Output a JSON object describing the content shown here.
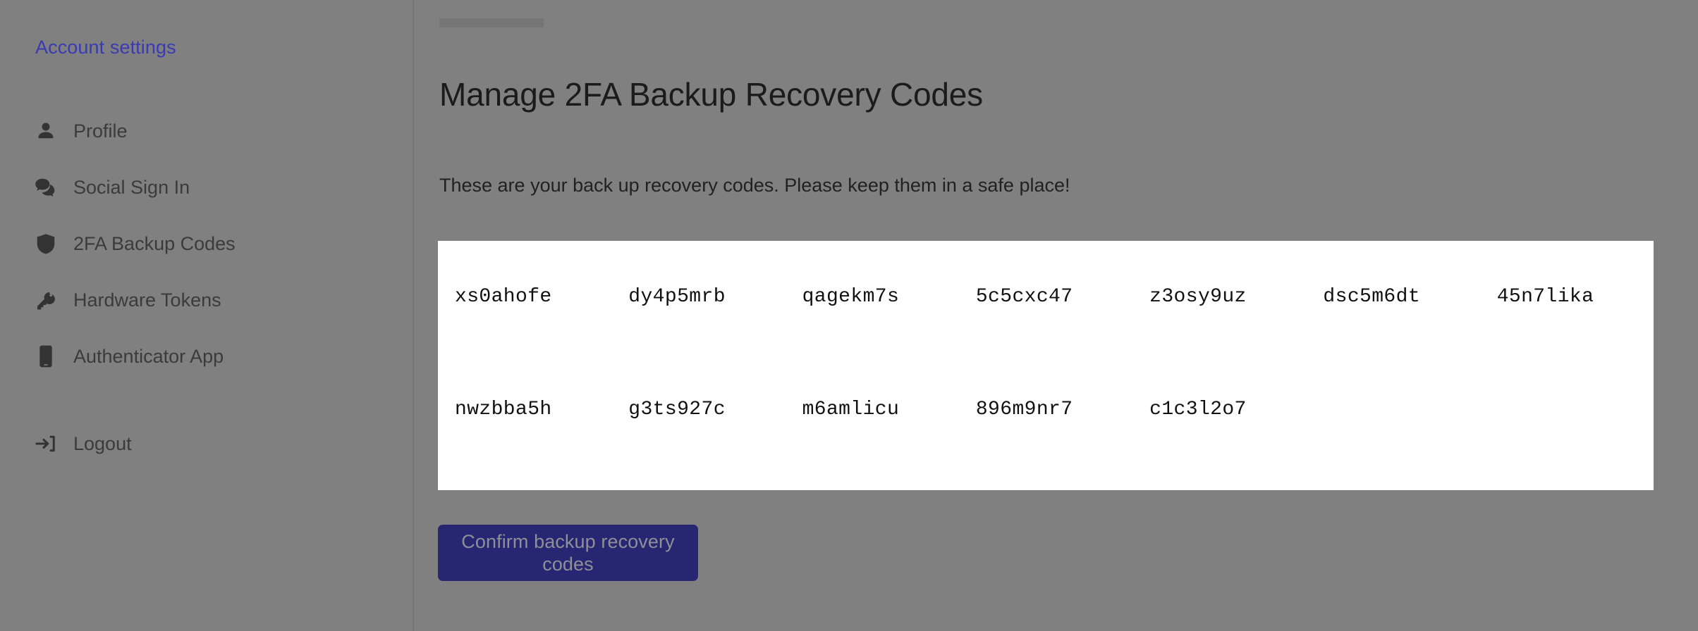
{
  "sidebar": {
    "account_link": "Account settings",
    "items": [
      {
        "label": "Profile",
        "icon": "person-icon",
        "name": "sidebar-item-profile"
      },
      {
        "label": "Social Sign In",
        "icon": "chat-bubbles-icon",
        "name": "sidebar-item-social-sign-in"
      },
      {
        "label": "2FA Backup Codes",
        "icon": "shield-icon",
        "name": "sidebar-item-2fa-backup-codes"
      },
      {
        "label": "Hardware Tokens",
        "icon": "key-icon",
        "name": "sidebar-item-hardware-tokens"
      },
      {
        "label": "Authenticator App",
        "icon": "mobile-phone-icon",
        "name": "sidebar-item-authenticator-app"
      }
    ],
    "logout": {
      "label": "Logout",
      "icon": "logout-arrow-icon",
      "name": "sidebar-item-logout"
    }
  },
  "main": {
    "title": "Manage 2FA Backup Recovery Codes",
    "description": "These are your back up recovery codes. Please keep them in a safe place!",
    "recovery_codes": [
      "xs0ahofe",
      "dy4p5mrb",
      "qagekm7s",
      "5c5cxc47",
      "z3osy9uz",
      "dsc5m6dt",
      "45n7lika",
      "nwzbba5h",
      "g3ts927c",
      "m6amlicu",
      "896m9nr7",
      "c1c3l2o7"
    ],
    "confirm_button": "Confirm backup recovery codes"
  },
  "colors": {
    "page_background": "#808080",
    "panel_background": "#ffffff",
    "link": "#3a3ab2",
    "button_background": "#262672",
    "button_text": "#8f8f97",
    "icon": "#333333",
    "nav_text": "#3b3b3b",
    "heading_text": "#1b1b1b"
  }
}
